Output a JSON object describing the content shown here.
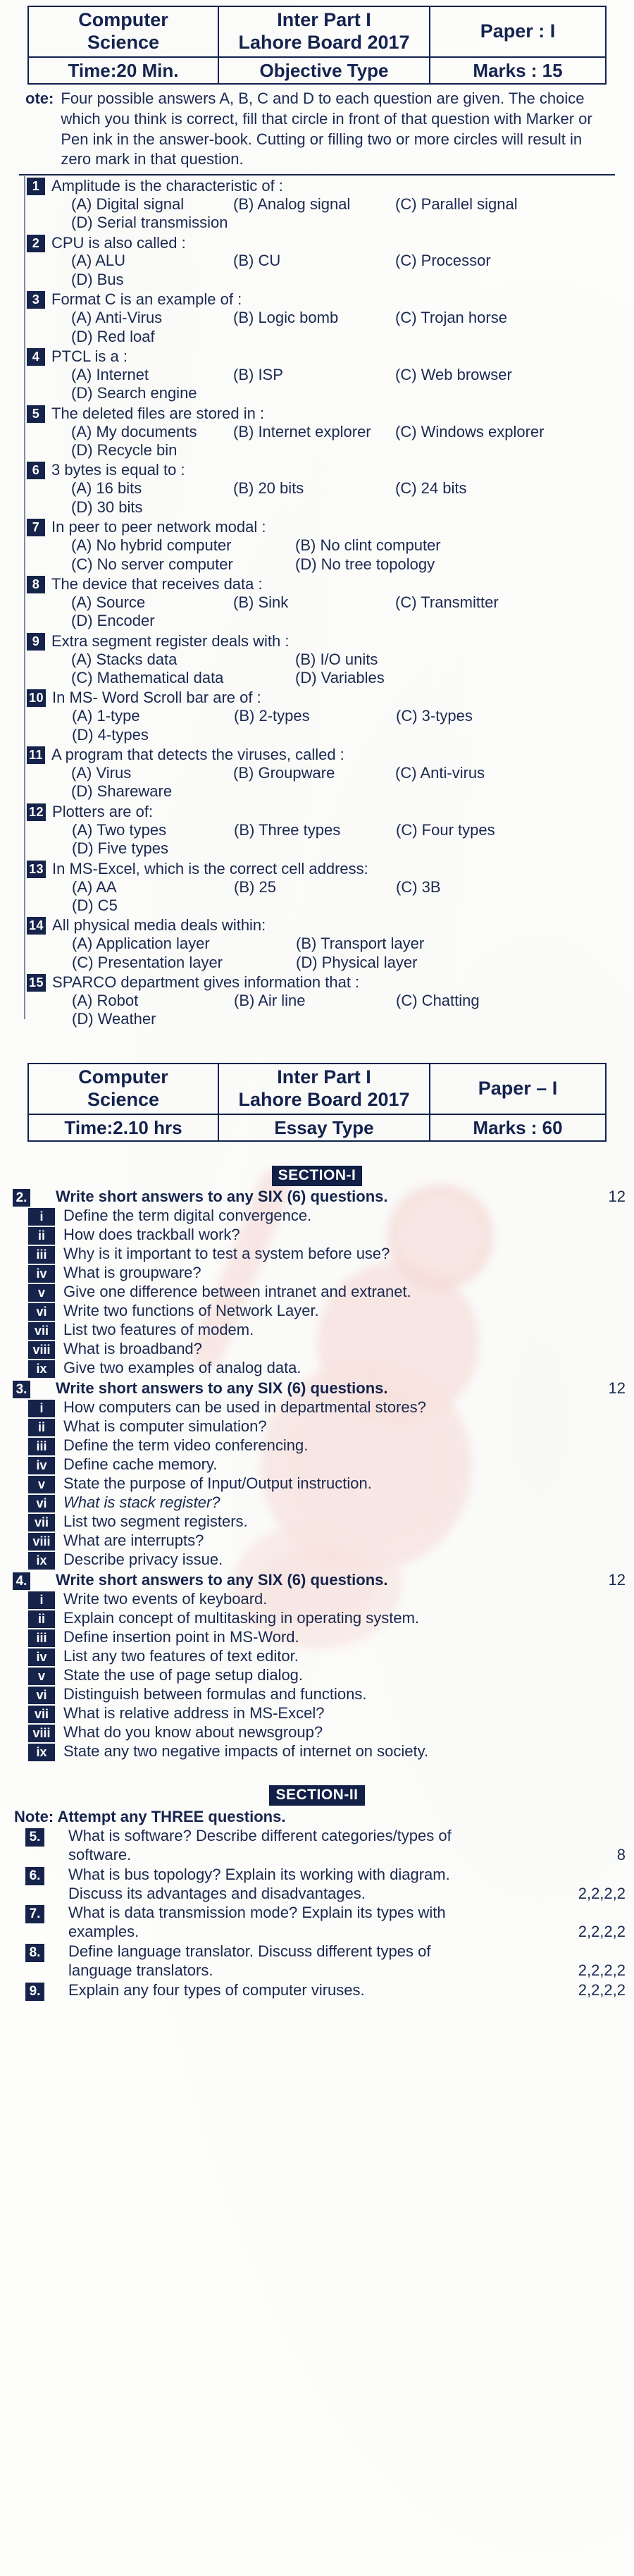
{
  "objective": {
    "header": {
      "subject": "Computer\nScience",
      "exam": "Inter Part I\nLahore Board 2017",
      "paper": "Paper : I",
      "time": "Time:20 Min.",
      "type": "Objective Type",
      "marks": "Marks : 15"
    },
    "note": {
      "label": "ote:",
      "text": "Four possible answers A, B, C and D to each question are given. The choice which you think is correct, fill that circle in front of that question with Marker or Pen ink in the answer-book. Cutting or filling two or more circles will result in zero mark in that question."
    },
    "questions": [
      {
        "num": "1",
        "text": "Amplitude is the characteristic of :",
        "width": "normal",
        "options": [
          "(A) Digital signal",
          "(B) Analog signal",
          "(C) Parallel signal",
          "(D) Serial transmission"
        ]
      },
      {
        "num": "2",
        "text": "CPU is also called :",
        "width": "normal",
        "options": [
          "(A) ALU",
          "(B) CU",
          "(C) Processor",
          "(D) Bus"
        ]
      },
      {
        "num": "3",
        "text": "Format C is an example of :",
        "width": "normal",
        "options": [
          "(A) Anti-Virus",
          "(B) Logic bomb",
          "(C) Trojan horse",
          "(D) Red loaf"
        ]
      },
      {
        "num": "4",
        "text": "PTCL is a :",
        "width": "normal",
        "options": [
          "(A) Internet",
          "(B) ISP",
          "(C) Web browser",
          "(D) Search engine"
        ]
      },
      {
        "num": "5",
        "text": "The deleted files are stored in :",
        "width": "normal",
        "options": [
          "(A) My documents",
          "(B) Internet explorer",
          "(C) Windows explorer",
          "(D) Recycle bin"
        ]
      },
      {
        "num": "6",
        "text": "3 bytes is equal to :",
        "width": "normal",
        "options": [
          "(A) 16 bits",
          "(B) 20 bits",
          "(C) 24 bits",
          "(D) 30 bits"
        ]
      },
      {
        "num": "7",
        "text": "In peer to peer network modal :",
        "width": "xwide",
        "options": [
          "(A) No hybrid computer",
          "(B) No clint computer",
          "(C) No server computer",
          "(D) No tree topology"
        ]
      },
      {
        "num": "8",
        "text": "The device that receives data :",
        "width": "normal",
        "options": [
          "(A) Source",
          "(B) Sink",
          "(C) Transmitter",
          "(D) Encoder"
        ]
      },
      {
        "num": "9",
        "text": "Extra segment register deals with :",
        "width": "xwide",
        "options": [
          "(A) Stacks data",
          "(B) I/O units",
          "(C) Mathematical data",
          "(D) Variables"
        ]
      },
      {
        "num": "10",
        "text": "In MS- Word Scroll bar are of :",
        "width": "normal",
        "options": [
          "(A) 1-type",
          "(B) 2-types",
          "(C) 3-types",
          "(D) 4-types"
        ]
      },
      {
        "num": "11",
        "text": "A program that detects the viruses, called :",
        "width": "normal",
        "options": [
          "(A) Virus",
          "(B) Groupware",
          "(C) Anti-virus",
          "(D) Shareware"
        ]
      },
      {
        "num": "12",
        "text": "Plotters are of:",
        "width": "normal",
        "options": [
          "(A) Two types",
          "(B) Three types",
          "(C) Four types",
          "(D) Five types"
        ]
      },
      {
        "num": "13",
        "text": "In MS-Excel, which is the correct cell address:",
        "width": "normal",
        "options": [
          "(A) AA",
          "(B) 25",
          "(C) 3B",
          "(D) C5"
        ]
      },
      {
        "num": "14",
        "text": "All physical media deals within:",
        "width": "xwide",
        "options": [
          "(A) Application layer",
          "(B) Transport layer",
          "(C) Presentation layer",
          "(D) Physical layer"
        ]
      },
      {
        "num": "15",
        "text": "SPARCO department gives information that :",
        "width": "normal",
        "options": [
          "(A) Robot",
          "(B) Air line",
          "(C) Chatting",
          "(D) Weather"
        ]
      }
    ]
  },
  "subjective": {
    "header": {
      "subject": "Computer\nScience",
      "exam": "Inter Part I\nLahore Board 2017",
      "paper": "Paper – I",
      "time": "Time:2.10 hrs",
      "type": "Essay Type",
      "marks": "Marks : 60"
    },
    "section1": {
      "banner": "SECTION-I",
      "questions": [
        {
          "num": "2.",
          "text": "Write short answers to any SIX (6) questions.",
          "marks": "12",
          "subs": [
            {
              "rn": "i",
              "text": "Define the term digital convergence.",
              "italic": false
            },
            {
              "rn": "ii",
              "text": "How does trackball work?",
              "italic": false
            },
            {
              "rn": "iii",
              "text": "Why is it important to test a system before use?",
              "italic": false
            },
            {
              "rn": "iv",
              "text": "What is groupware?",
              "italic": false
            },
            {
              "rn": "v",
              "text": "Give one difference between intranet and extranet.",
              "italic": false
            },
            {
              "rn": "vi",
              "text": "Write two functions of Network Layer.",
              "italic": false
            },
            {
              "rn": "vii",
              "text": "List two features of modem.",
              "italic": false
            },
            {
              "rn": "viii",
              "text": "What is broadband?",
              "italic": false
            },
            {
              "rn": "ix",
              "text": "Give two examples of analog data.",
              "italic": false
            }
          ]
        },
        {
          "num": "3.",
          "text": "Write short answers to any SIX (6) questions.",
          "marks": "12",
          "subs": [
            {
              "rn": "i",
              "text": "How computers can be used in departmental stores?",
              "italic": false
            },
            {
              "rn": "ii",
              "text": "What is computer simulation?",
              "italic": false
            },
            {
              "rn": "iii",
              "text": "Define the term video conferencing.",
              "italic": false
            },
            {
              "rn": "iv",
              "text": "Define cache memory.",
              "italic": false
            },
            {
              "rn": "v",
              "text": "State the purpose of Input/Output instruction.",
              "italic": false
            },
            {
              "rn": "vi",
              "text": "What is stack register?",
              "italic": true
            },
            {
              "rn": "vii",
              "text": "List two segment registers.",
              "italic": false
            },
            {
              "rn": "viii",
              "text": "What are interrupts?",
              "italic": false
            },
            {
              "rn": "ix",
              "text": "Describe privacy issue.",
              "italic": false
            }
          ]
        },
        {
          "num": "4.",
          "text": "Write short answers to any SIX (6) questions.",
          "marks": "12",
          "subs": [
            {
              "rn": "i",
              "text": "Write two events of keyboard.",
              "italic": false
            },
            {
              "rn": "ii",
              "text": "Explain concept of multitasking in operating system.",
              "italic": false
            },
            {
              "rn": "iii",
              "text": "Define insertion point in MS-Word.",
              "italic": false
            },
            {
              "rn": "iv",
              "text": "List any two features of text editor.",
              "italic": false
            },
            {
              "rn": "v",
              "text": "State the use of page setup dialog.",
              "italic": false
            },
            {
              "rn": "vi",
              "text": "Distinguish between formulas and functions.",
              "italic": false
            },
            {
              "rn": "vii",
              "text": "What is relative address in MS-Excel?",
              "italic": false
            },
            {
              "rn": "viii",
              "text": "What do you know about newsgroup?",
              "italic": false
            },
            {
              "rn": "ix",
              "text": "State any two negative impacts of internet on society.",
              "italic": false
            }
          ]
        }
      ]
    },
    "section2": {
      "banner": "SECTION-II",
      "note": "Note: Attempt any THREE questions.",
      "questions": [
        {
          "num": "5.",
          "lines": [
            {
              "text": "What is software? Describe different categories/types of",
              "marks": ""
            },
            {
              "text": "software.",
              "marks": "8"
            }
          ]
        },
        {
          "num": "6.",
          "lines": [
            {
              "text": "What is bus topology? Explain its working with diagram.",
              "marks": ""
            },
            {
              "text": "Discuss its advantages and disadvantages.",
              "marks": "2,2,2,2"
            }
          ]
        },
        {
          "num": "7.",
          "lines": [
            {
              "text": "What is data transmission mode? Explain its types with",
              "marks": ""
            },
            {
              "text": "examples.",
              "marks": "2,2,2,2"
            }
          ]
        },
        {
          "num": "8.",
          "lines": [
            {
              "text": "Define language translator. Discuss different types of",
              "marks": ""
            },
            {
              "text": "language translators.",
              "marks": "2,2,2,2"
            }
          ]
        },
        {
          "num": "9.",
          "lines": [
            {
              "text": "Explain any four types of computer viruses.",
              "marks": "2,2,2,2"
            }
          ]
        }
      ]
    }
  }
}
